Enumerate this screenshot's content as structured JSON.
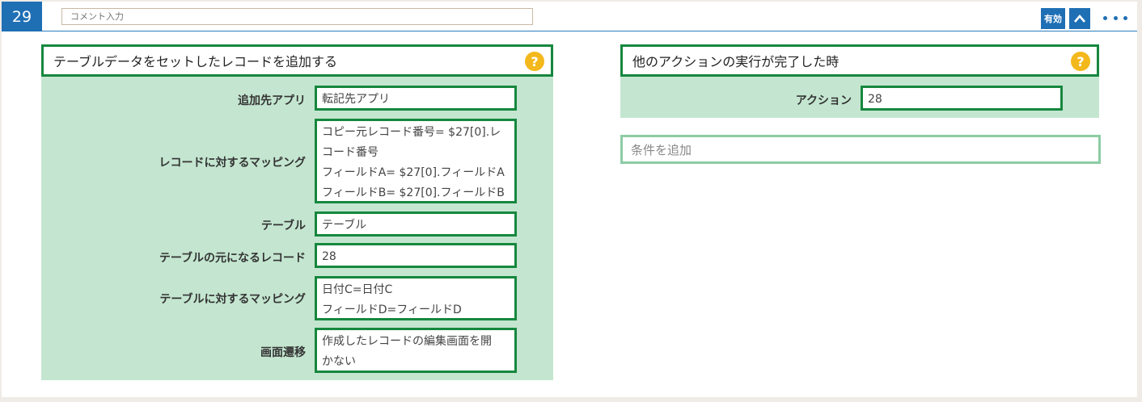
{
  "header": {
    "number": "29",
    "comment_placeholder": "コメント入力",
    "enabled_label": "有効",
    "collapse_icon": "chevron-up-icon",
    "more_icon": "more-dots-icon"
  },
  "action": {
    "title": "テーブルデータをセットしたレコードを追加する",
    "help": "?",
    "fields": [
      {
        "label": "追加先アプリ",
        "value_lines": [
          "転記先アプリ"
        ]
      },
      {
        "label": "レコードに対するマッピング",
        "value_lines": [
          "コピー元レコード番号= $27[0].レ",
          "コード番号",
          "フィールドA= $27[0].フィールドA",
          "フィールドB= $27[0].フィールドB"
        ]
      },
      {
        "label": "テーブル",
        "value_lines": [
          "テーブル"
        ]
      },
      {
        "label": "テーブルの元になるレコード",
        "value_lines": [
          "28"
        ]
      },
      {
        "label": "テーブルに対するマッピング",
        "value_lines": [
          "日付C=日付C",
          "フィールドD=フィールドD"
        ]
      },
      {
        "label": "画面遷移",
        "value_lines": [
          "作成したレコードの編集画面を開",
          "かない"
        ]
      }
    ]
  },
  "trigger": {
    "title": "他のアクションの実行が完了した時",
    "help": "?",
    "fields": [
      {
        "label": "アクション",
        "value_lines": [
          "28"
        ]
      }
    ]
  },
  "add_condition": "条件を追加",
  "colors": {
    "accent_blue": "#1f6fb5",
    "panel_green": "#c4e6d0",
    "border_green": "#16873e",
    "help_yellow": "#f3b81c"
  }
}
